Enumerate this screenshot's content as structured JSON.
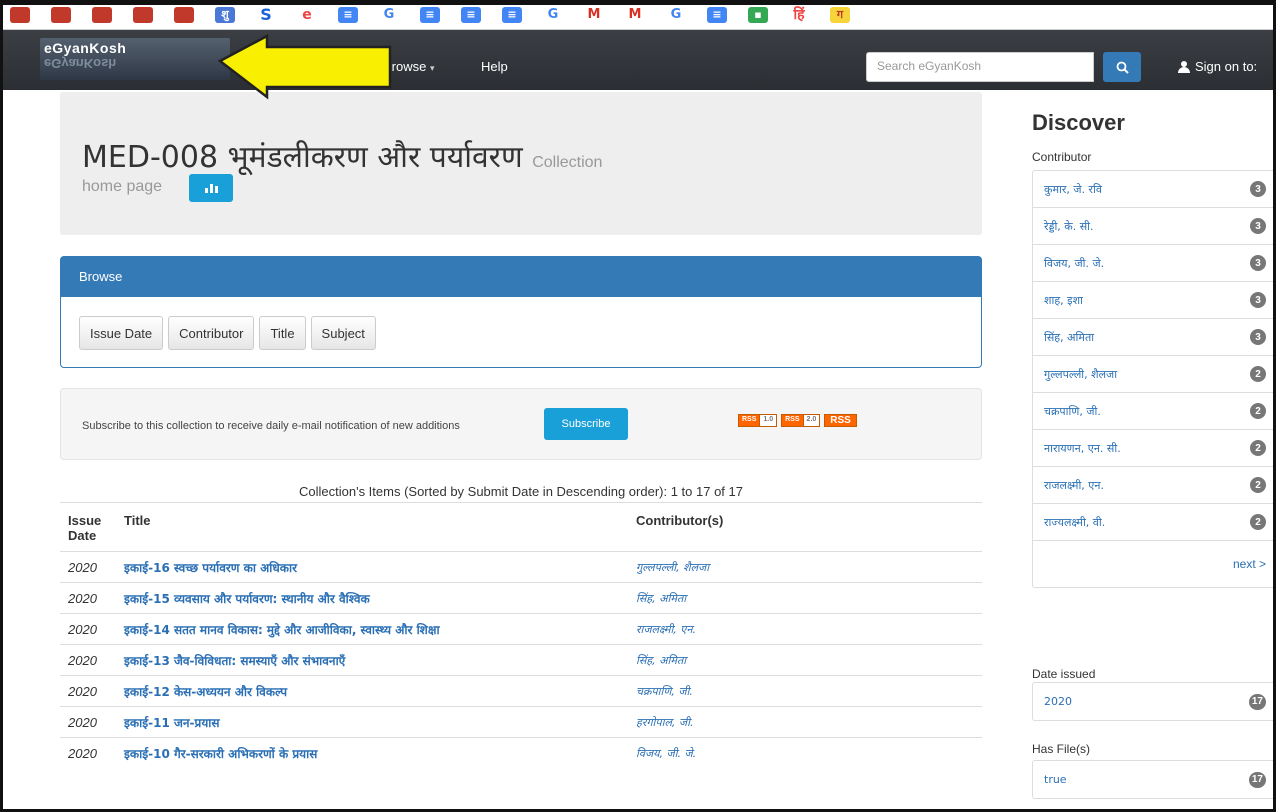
{
  "bookmarks": [
    {
      "icon": "red-square-icon",
      "glyph": ""
    },
    {
      "icon": "red-square-icon",
      "glyph": ""
    },
    {
      "icon": "red-square-icon",
      "glyph": ""
    },
    {
      "icon": "red-square-icon",
      "glyph": ""
    },
    {
      "icon": "red-square-icon",
      "glyph": ""
    },
    {
      "icon": "emblem-icon",
      "glyph": "शु"
    },
    {
      "icon": "s-icon",
      "glyph": "S"
    },
    {
      "icon": "e-icon",
      "glyph": "e"
    },
    {
      "icon": "docs-icon",
      "glyph": "≡"
    },
    {
      "icon": "google-icon",
      "glyph": "G"
    },
    {
      "icon": "docs-icon",
      "glyph": "≡"
    },
    {
      "icon": "docs-icon",
      "glyph": "≡"
    },
    {
      "icon": "docs-icon",
      "glyph": "≡"
    },
    {
      "icon": "google-icon",
      "glyph": "G"
    },
    {
      "icon": "gmail-icon",
      "glyph": "M"
    },
    {
      "icon": "gmail-icon",
      "glyph": "M"
    },
    {
      "icon": "google-icon",
      "glyph": "G"
    },
    {
      "icon": "docs-icon",
      "glyph": "≡"
    },
    {
      "icon": "classroom-icon",
      "glyph": "▪"
    },
    {
      "icon": "hindi-icon",
      "glyph": "हिं"
    },
    {
      "icon": "yellow-icon",
      "glyph": "ग"
    }
  ],
  "navbar": {
    "brand": "eGyanKosh",
    "browse": "Browse",
    "help": "Help",
    "search_placeholder": "Search eGyanKosh",
    "signon": "Sign on to:"
  },
  "header": {
    "title": "MED-008 भूमंडलीकरण और पर्यावरण",
    "title_suffix": "Collection",
    "subtitle": "home page"
  },
  "browse": {
    "heading": "Browse",
    "buttons": [
      "Issue Date",
      "Contributor",
      "Title",
      "Subject"
    ]
  },
  "subscribe": {
    "text": "Subscribe to this collection to receive daily e-mail notification of new additions",
    "button": "Subscribe",
    "feeds": [
      {
        "l": "RSS",
        "r": "1.0"
      },
      {
        "l": "RSS",
        "r": "2.0"
      }
    ],
    "rss": "RSS"
  },
  "items": {
    "caption": "Collection's Items (Sorted by Submit Date in Descending order): 1 to 17 of 17",
    "headers": {
      "date": "Issue Date",
      "title": "Title",
      "contributor": "Contributor(s)"
    },
    "rows": [
      {
        "date": "2020",
        "title": "इकाई-16 स्वच्छ पर्यावरण का अधिकार",
        "contributor": "गुल्लपल्ली, शैलजा"
      },
      {
        "date": "2020",
        "title": "इकाई-15 व्यवसाय और पर्यावरण: स्थानीय और वैश्विक",
        "contributor": "सिंह, अमिता"
      },
      {
        "date": "2020",
        "title": "इकाई-14 सतत मानव विकास: मुद्दे और आजीविका, स्वास्थ्य और शिक्षा",
        "contributor": "राजलक्ष्मी, एन."
      },
      {
        "date": "2020",
        "title": "इकाई-13 जैव-विविधता: समस्याएँ और संभावनाएँ",
        "contributor": "सिंह, अमिता"
      },
      {
        "date": "2020",
        "title": "इकाई-12 केस-अध्ययन और विकल्प",
        "contributor": "चक्रपाणि, जी."
      },
      {
        "date": "2020",
        "title": "इकाई-11 जन-प्रयास",
        "contributor": "हरगोपाल, जी."
      },
      {
        "date": "2020",
        "title": "इकाई-10 गैर-सरकारी अभिकरणों के प्रयास",
        "contributor": "विजय, जी. जे."
      }
    ]
  },
  "sidebar": {
    "discover": "Discover",
    "contributor_label": "Contributor",
    "contributors": [
      {
        "name": "कुमार, जे. रवि",
        "count": "3"
      },
      {
        "name": "रेड्डी, के. सी.",
        "count": "3"
      },
      {
        "name": "विजय, जी. जे.",
        "count": "3"
      },
      {
        "name": "शाह, इशा",
        "count": "3"
      },
      {
        "name": "सिंह, अमिता",
        "count": "3"
      },
      {
        "name": "गुल्लपल्ली, शैलजा",
        "count": "2"
      },
      {
        "name": "चक्रपाणि, जी.",
        "count": "2"
      },
      {
        "name": "नारायणन, एन. सी.",
        "count": "2"
      },
      {
        "name": "राजलक्ष्मी, एन.",
        "count": "2"
      },
      {
        "name": "राज्यलक्ष्मी, वी.",
        "count": "2"
      }
    ],
    "next": "next >",
    "date_label": "Date issued",
    "dates": [
      {
        "name": "2020",
        "count": "17"
      }
    ],
    "hasfile_label": "Has File(s)",
    "hasfiles": [
      {
        "name": "true",
        "count": "17"
      }
    ]
  }
}
